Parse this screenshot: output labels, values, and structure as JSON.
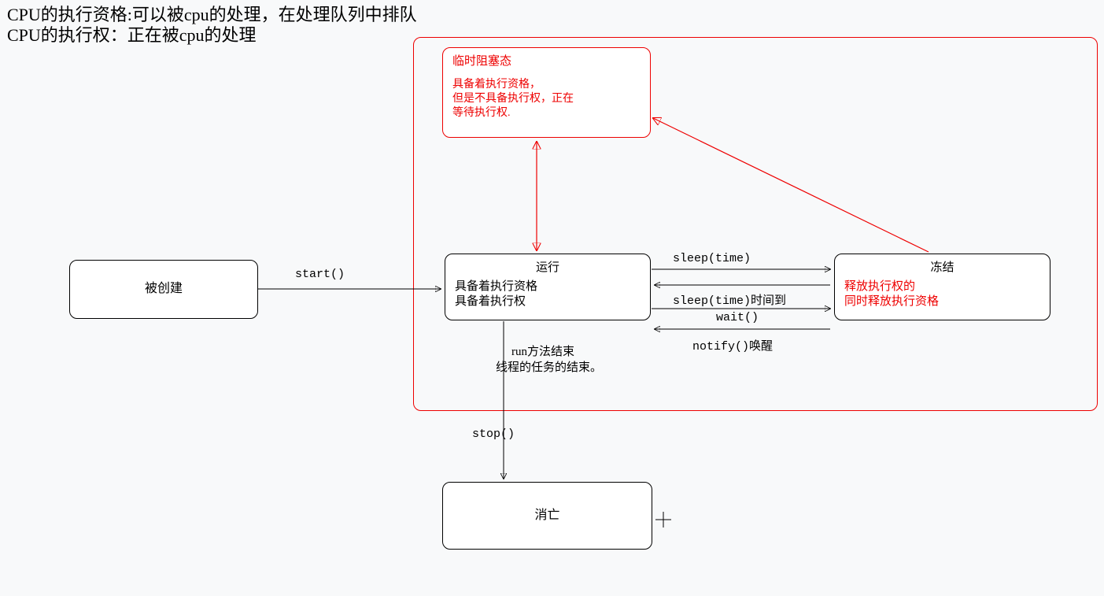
{
  "headings": {
    "line1": "CPU的执行资格:可以被cpu的处理，在处理队列中排队",
    "line2": "CPU的执行权：正在被cpu的处理"
  },
  "nodes": {
    "created": {
      "title": "被创建"
    },
    "blocked": {
      "title": "临时阻塞态",
      "desc1": "具备着执行资格，",
      "desc2": "但是不具备执行权，正在",
      "desc3": "等待执行权."
    },
    "running": {
      "title": "运行",
      "desc1": "具备着执行资格",
      "desc2": "具备着执行权"
    },
    "frozen": {
      "title": "冻结",
      "desc1": "释放执行权的",
      "desc2": "同时释放执行资格"
    },
    "dead": {
      "title": "消亡"
    }
  },
  "edges": {
    "start": "start()",
    "sleep": "sleep(time)",
    "sleep_back": "sleep(time)时间到",
    "wait": "wait()",
    "notify": "notify()唤醒",
    "run_end1": "run方法结束",
    "run_end2": "线程的任务的结束。",
    "stop": "stop()"
  }
}
